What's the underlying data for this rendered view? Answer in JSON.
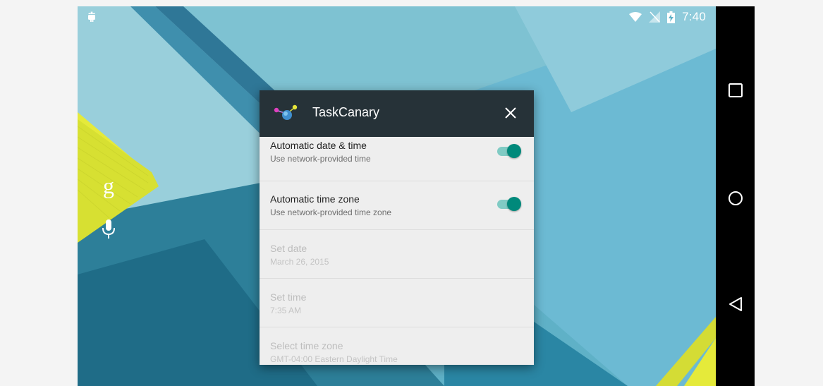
{
  "status_bar": {
    "time": "7:40",
    "left_icon": "android-debug-icon",
    "right_icons": [
      "wifi-icon",
      "no-signal-icon",
      "battery-charging-icon"
    ]
  },
  "home": {
    "google_label": "g",
    "mic_icon": "mic-icon"
  },
  "dialog": {
    "app_title": "TaskCanary",
    "close_icon": "close-icon",
    "settings": [
      {
        "title": "Automatic date & time",
        "subtitle": "Use network-provided time",
        "enabled": true,
        "toggle": "on"
      },
      {
        "title": "Automatic time zone",
        "subtitle": "Use network-provided time zone",
        "enabled": true,
        "toggle": "on"
      },
      {
        "title": "Set date",
        "subtitle": "March 26, 2015",
        "enabled": false
      },
      {
        "title": "Set time",
        "subtitle": "7:35 AM",
        "enabled": false
      },
      {
        "title": "Select time zone",
        "subtitle": "GMT-04:00 Eastern Daylight Time",
        "enabled": false
      }
    ]
  },
  "nav_bar": {
    "buttons": [
      "recents-icon",
      "home-icon",
      "back-icon"
    ]
  },
  "colors": {
    "titlebar": "#263238",
    "switch_on": "#00897b",
    "switch_track": "#80cbc4",
    "dialog_bg": "#eeeeee"
  }
}
